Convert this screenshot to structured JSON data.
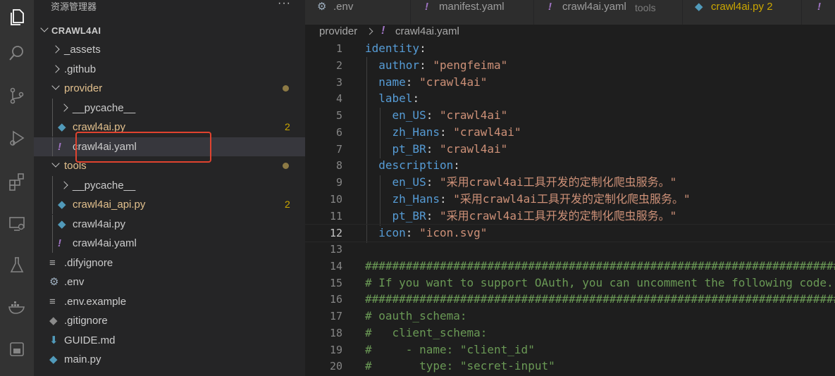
{
  "sidebar": {
    "title": "资源管理器",
    "more": "···",
    "root": "CRAWL4AI",
    "items": [
      {
        "label": "_assets",
        "kind": "folder",
        "state": "collapsed",
        "status": ""
      },
      {
        "label": ".github",
        "kind": "folder",
        "state": "collapsed",
        "status": ""
      },
      {
        "label": "provider",
        "kind": "folder",
        "state": "expanded",
        "status": "dot"
      },
      {
        "label": "__pycache__",
        "kind": "folder",
        "state": "collapsed",
        "status": ""
      },
      {
        "label": "crawl4ai.py",
        "kind": "python",
        "status": "2"
      },
      {
        "label": "crawl4ai.yaml",
        "kind": "yaml",
        "status": "",
        "selected": true
      },
      {
        "label": "tools",
        "kind": "folder",
        "state": "expanded",
        "status": "dot"
      },
      {
        "label": "__pycache__",
        "kind": "folder",
        "state": "collapsed",
        "status": ""
      },
      {
        "label": "crawl4ai_api.py",
        "kind": "python",
        "status": "2"
      },
      {
        "label": "crawl4ai.py",
        "kind": "python",
        "status": ""
      },
      {
        "label": "crawl4ai.yaml",
        "kind": "yaml",
        "status": ""
      },
      {
        "label": ".difyignore",
        "kind": "text",
        "status": ""
      },
      {
        "label": ".env",
        "kind": "settings",
        "status": ""
      },
      {
        "label": ".env.example",
        "kind": "text",
        "status": ""
      },
      {
        "label": ".gitignore",
        "kind": "git",
        "status": ""
      },
      {
        "label": "GUIDE.md",
        "kind": "markdown",
        "status": ""
      },
      {
        "label": "main.py",
        "kind": "python",
        "status": ""
      }
    ]
  },
  "tabs": [
    {
      "label": ".env",
      "icon": "gear-icon",
      "description": ""
    },
    {
      "label": "manifest.yaml",
      "icon": "yaml-icon",
      "description": ""
    },
    {
      "label": "crawl4ai.yaml",
      "icon": "yaml-icon",
      "description": "tools"
    },
    {
      "label": "crawl4ai.py 2",
      "icon": "python-icon",
      "description": ""
    }
  ],
  "breadcrumb": {
    "folder": "provider",
    "file": "crawl4ai.yaml"
  },
  "editor": {
    "current_line": 12,
    "lines": [
      {
        "n": "1",
        "text": "identity:"
      },
      {
        "n": "2",
        "text": "  author: \"pengfeima\""
      },
      {
        "n": "3",
        "text": "  name: \"crawl4ai\""
      },
      {
        "n": "4",
        "text": "  label:"
      },
      {
        "n": "5",
        "text": "    en_US: \"crawl4ai\""
      },
      {
        "n": "6",
        "text": "    zh_Hans: \"crawl4ai\""
      },
      {
        "n": "7",
        "text": "    pt_BR: \"crawl4ai\""
      },
      {
        "n": "8",
        "text": "  description:"
      },
      {
        "n": "9",
        "text": "    en_US: \"采用crawl4ai工具开发的定制化爬虫服务。\""
      },
      {
        "n": "10",
        "text": "    zh_Hans: \"采用crawl4ai工具开发的定制化爬虫服务。\""
      },
      {
        "n": "11",
        "text": "    pt_BR: \"采用crawl4ai工具开发的定制化爬虫服务。\""
      },
      {
        "n": "12",
        "text": "  icon: \"icon.svg\""
      },
      {
        "n": "13",
        "text": ""
      },
      {
        "n": "14",
        "text": "##############################################################################################"
      },
      {
        "n": "15",
        "text": "# If you want to support OAuth, you can uncomment the following code."
      },
      {
        "n": "16",
        "text": "##############################################################################################"
      },
      {
        "n": "17",
        "text": "# oauth_schema:"
      },
      {
        "n": "18",
        "text": "#   client_schema:"
      },
      {
        "n": "19",
        "text": "#     - name: \"client_id\""
      },
      {
        "n": "20",
        "text": "#       type: \"secret-input\""
      }
    ]
  },
  "colors": {
    "keyword": "#569cd6",
    "string": "#ce9178",
    "comment": "#6a9955",
    "modified": "#cca700",
    "highlight_box": "#e0432f"
  }
}
